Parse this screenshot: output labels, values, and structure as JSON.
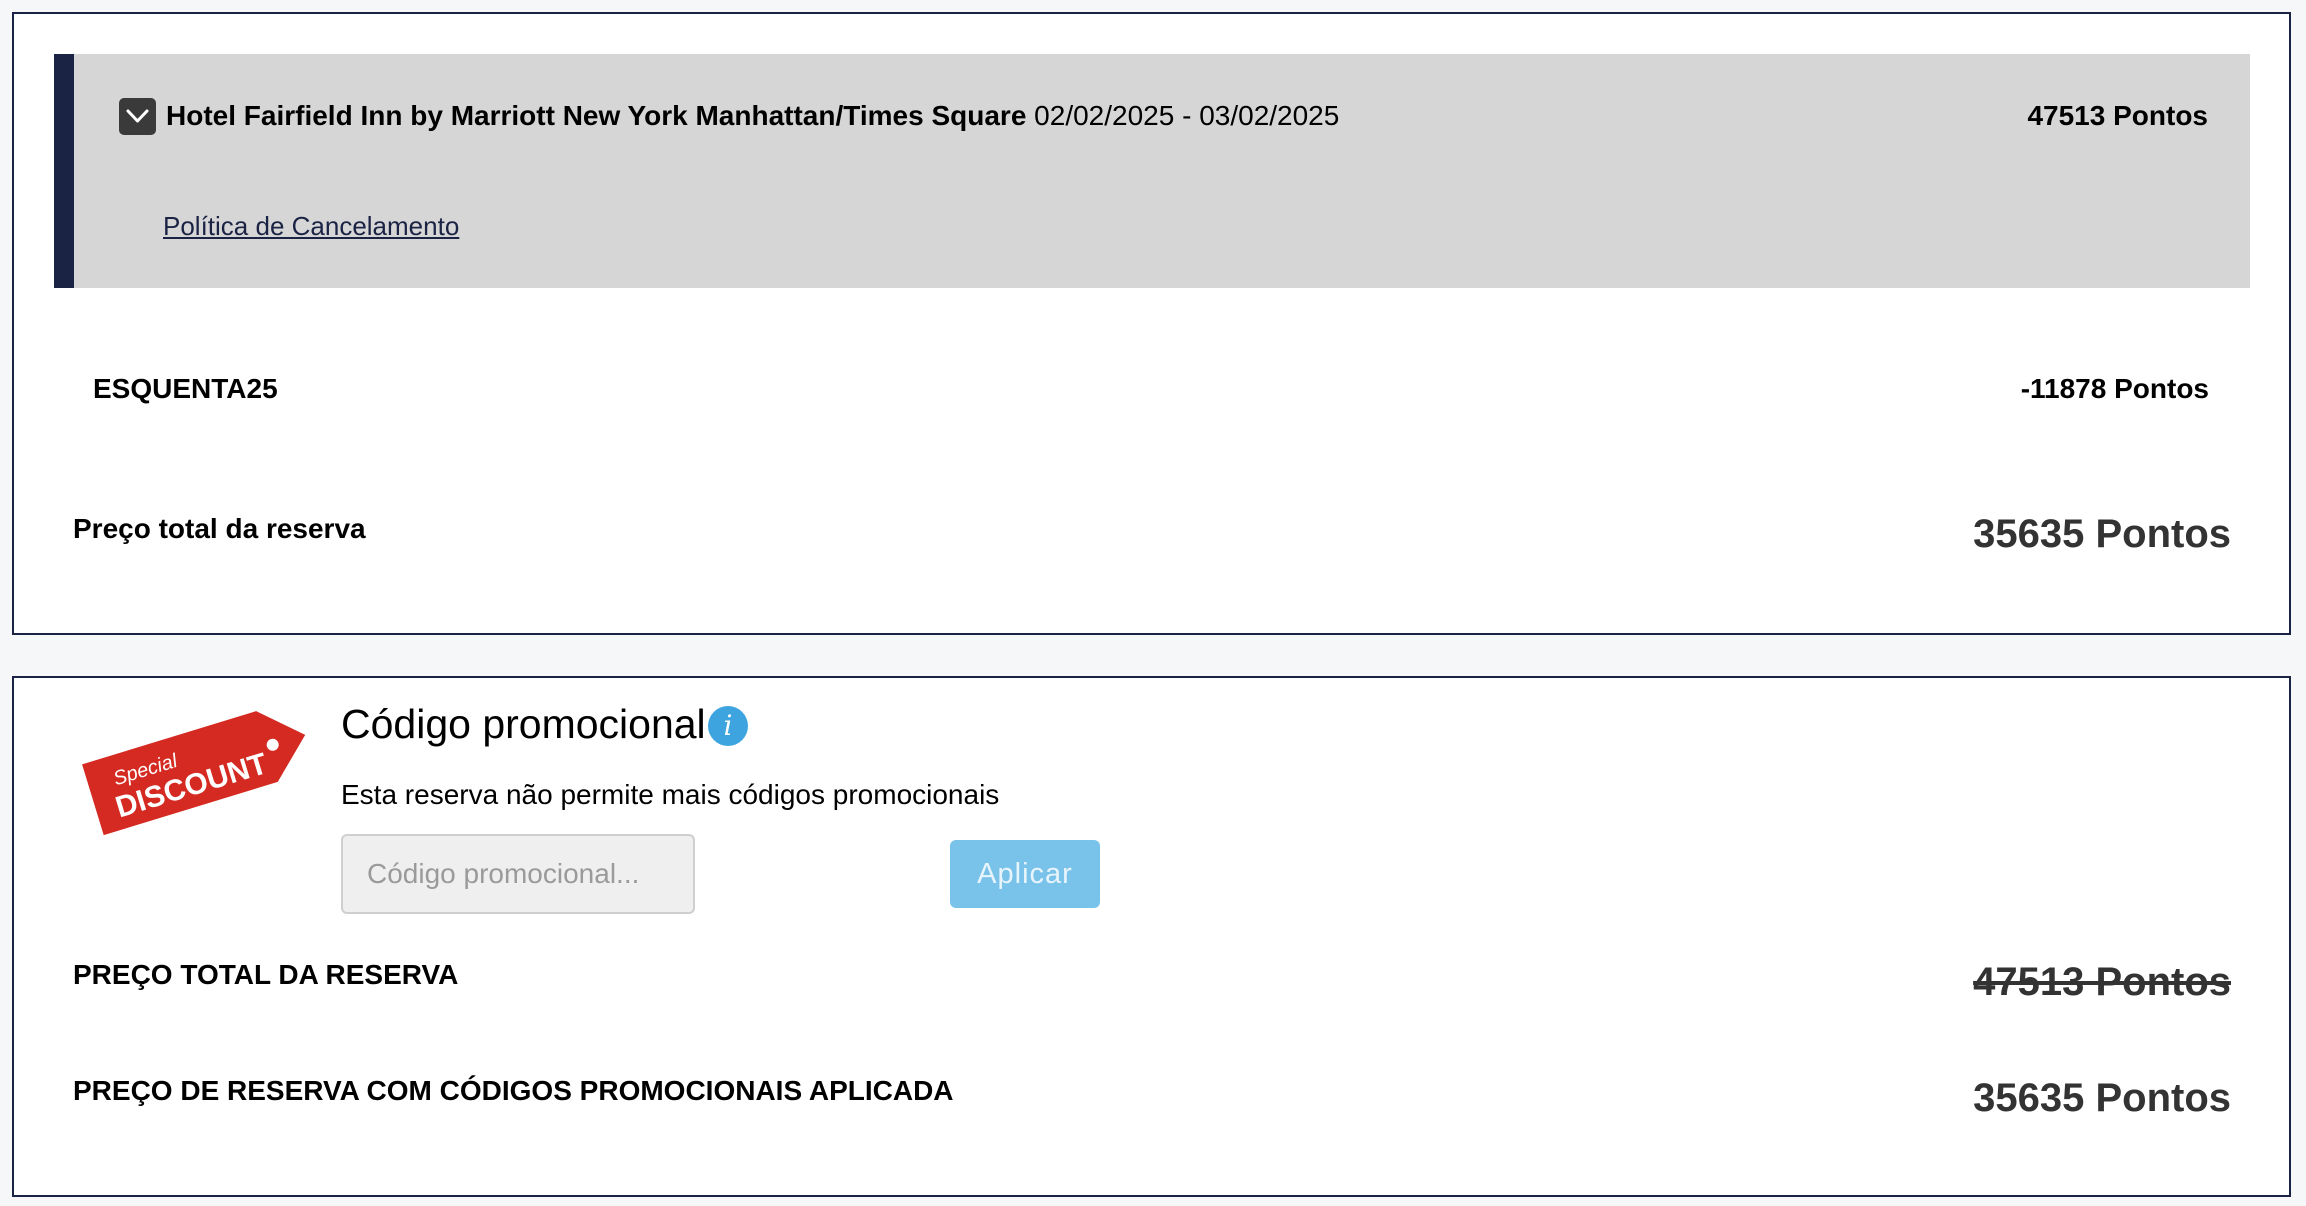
{
  "summary": {
    "hotel": {
      "name": "Hotel Fairfield Inn by Marriott New York Manhattan/Times Square",
      "dates": "02/02/2025 - 03/02/2025",
      "points": "47513 Pontos",
      "cancellation_link": "Política de Cancelamento"
    },
    "promo_line": {
      "code": "ESQUENTA25",
      "discount": "-11878 Pontos"
    },
    "total": {
      "label": "Preço total da reserva",
      "value": "35635 Pontos"
    }
  },
  "promo": {
    "tag": {
      "line1": "Special",
      "line2": "DISCOUNT",
      "color": "#d42a22"
    },
    "title": "Código promocional",
    "info_icon": "info-icon",
    "note": "Esta reserva não permite mais códigos promocionais",
    "input": {
      "placeholder": "Código promocional...",
      "value": ""
    },
    "apply_label": "Aplicar",
    "original_total": {
      "label": "PREÇO TOTAL DA RESERVA",
      "value": "47513 Pontos"
    },
    "final_total": {
      "label": "PREÇO DE RESERVA COM CÓDIGOS PROMOCIONAIS APLICADA",
      "value": "35635 Pontos"
    }
  },
  "colors": {
    "navy": "#1b2345",
    "hotel_block_bg": "#d6d6d6",
    "apply_button": "#79c3ea",
    "info_icon": "#3ea4e0"
  }
}
